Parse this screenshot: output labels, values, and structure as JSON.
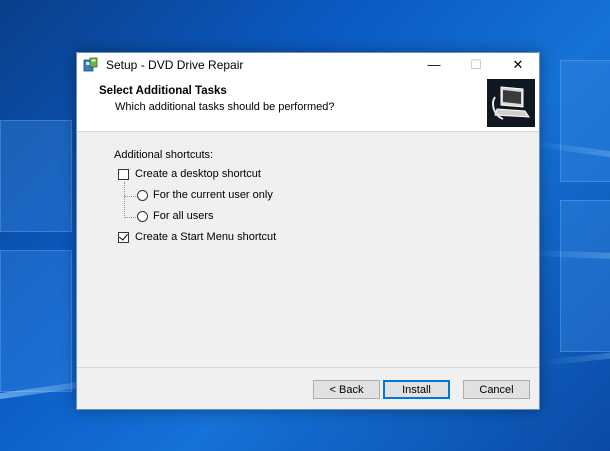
{
  "window": {
    "title": "Setup - DVD Drive Repair",
    "controls": {
      "minimize": "—",
      "maximize": "☐",
      "close": "✕"
    }
  },
  "header": {
    "title": "Select Additional Tasks",
    "subtitle": "Which additional tasks should be performed?"
  },
  "body": {
    "group_label": "Additional shortcuts:",
    "options": {
      "desktop_shortcut": "Create a desktop shortcut",
      "current_user": "For the current user only",
      "all_users": "For all users",
      "start_menu_shortcut": "Create a Start Menu shortcut"
    }
  },
  "footer": {
    "back": "< Back",
    "install": "Install",
    "cancel": "Cancel"
  },
  "colors": {
    "accent": "#0078d7",
    "desktop": "#0b5bc4"
  }
}
